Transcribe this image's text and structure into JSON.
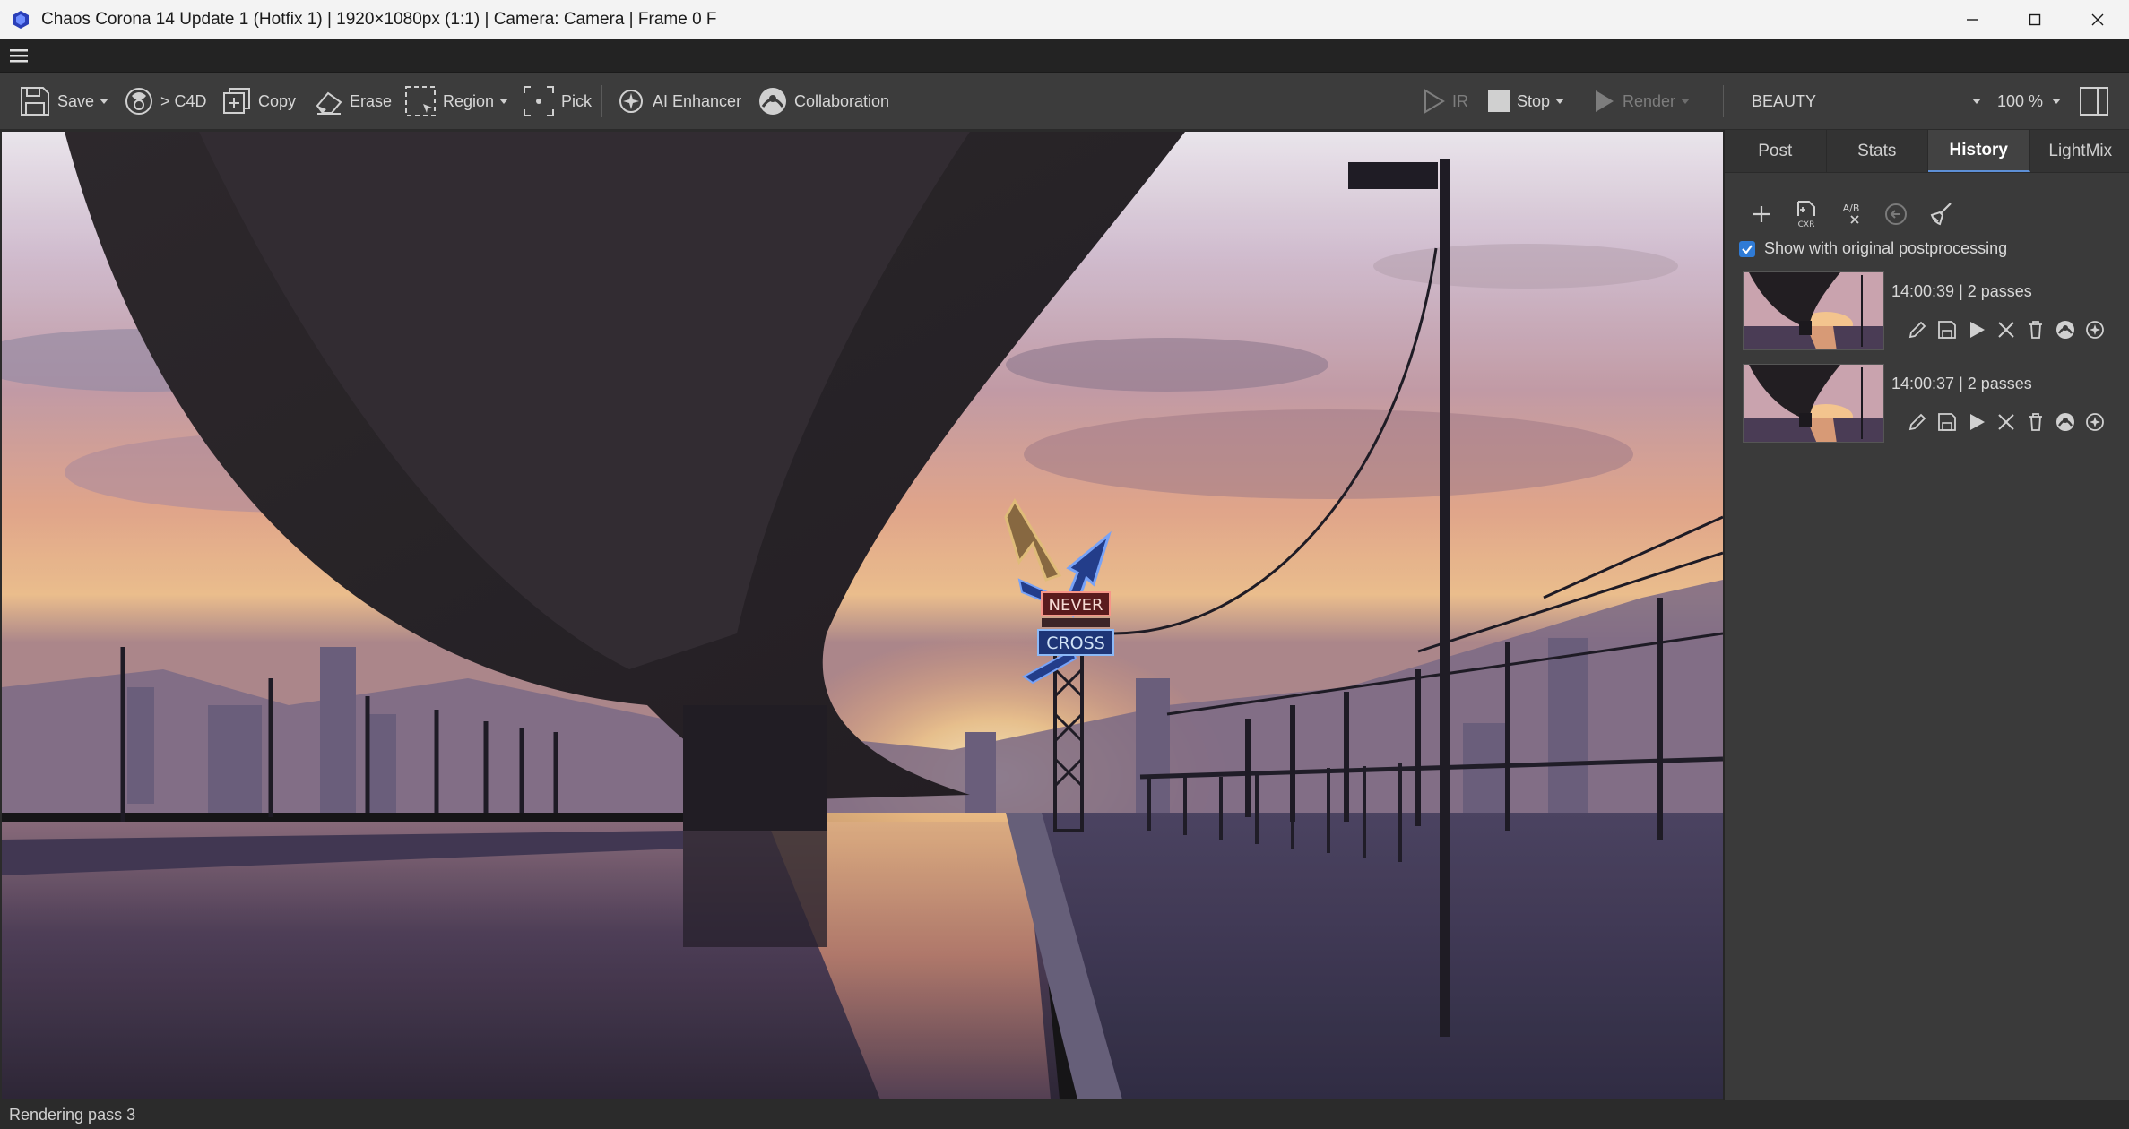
{
  "window": {
    "title": "Chaos Corona 14 Update 1 (Hotfix 1) | 1920×1080px (1:1) | Camera: Camera | Frame 0 F"
  },
  "toolbar": {
    "save_label": "Save",
    "c4d_label": "> C4D",
    "copy_label": "Copy",
    "erase_label": "Erase",
    "region_label": "Region",
    "pick_label": "Pick",
    "ai_enhancer_label": "AI Enhancer",
    "collaboration_label": "Collaboration",
    "ir_label": "IR",
    "stop_label": "Stop",
    "render_label": "Render",
    "pass_select_value": "BEAUTY",
    "zoom_value": "100 %"
  },
  "render_view": {
    "sign_top": "NEVER",
    "sign_bottom": "CROSS"
  },
  "panel": {
    "tabs": [
      {
        "label": "Post"
      },
      {
        "label": "Stats"
      },
      {
        "label": "History"
      },
      {
        "label": "LightMix"
      }
    ],
    "active_tab": "History",
    "history": {
      "tools": [
        "add-icon",
        "save-cxr-icon",
        "ab-compare-icon",
        "revert-icon",
        "clear-icon"
      ],
      "ab_text": "A/B",
      "cxr_text": "CXR",
      "show_original_label": "Show with original postprocessing",
      "show_original_checked": true,
      "entries": [
        {
          "time": "14:00:39",
          "passes": "2 passes",
          "label": "14:00:39 | 2 passes"
        },
        {
          "time": "14:00:37",
          "passes": "2 passes",
          "label": "14:00:37 | 2 passes"
        }
      ]
    }
  },
  "status": {
    "text": "Rendering pass 3"
  },
  "colors": {
    "accent": "#2f7bd6",
    "toolbar_bg": "#3c3c3c",
    "panel_bg": "#3a3a3a"
  }
}
